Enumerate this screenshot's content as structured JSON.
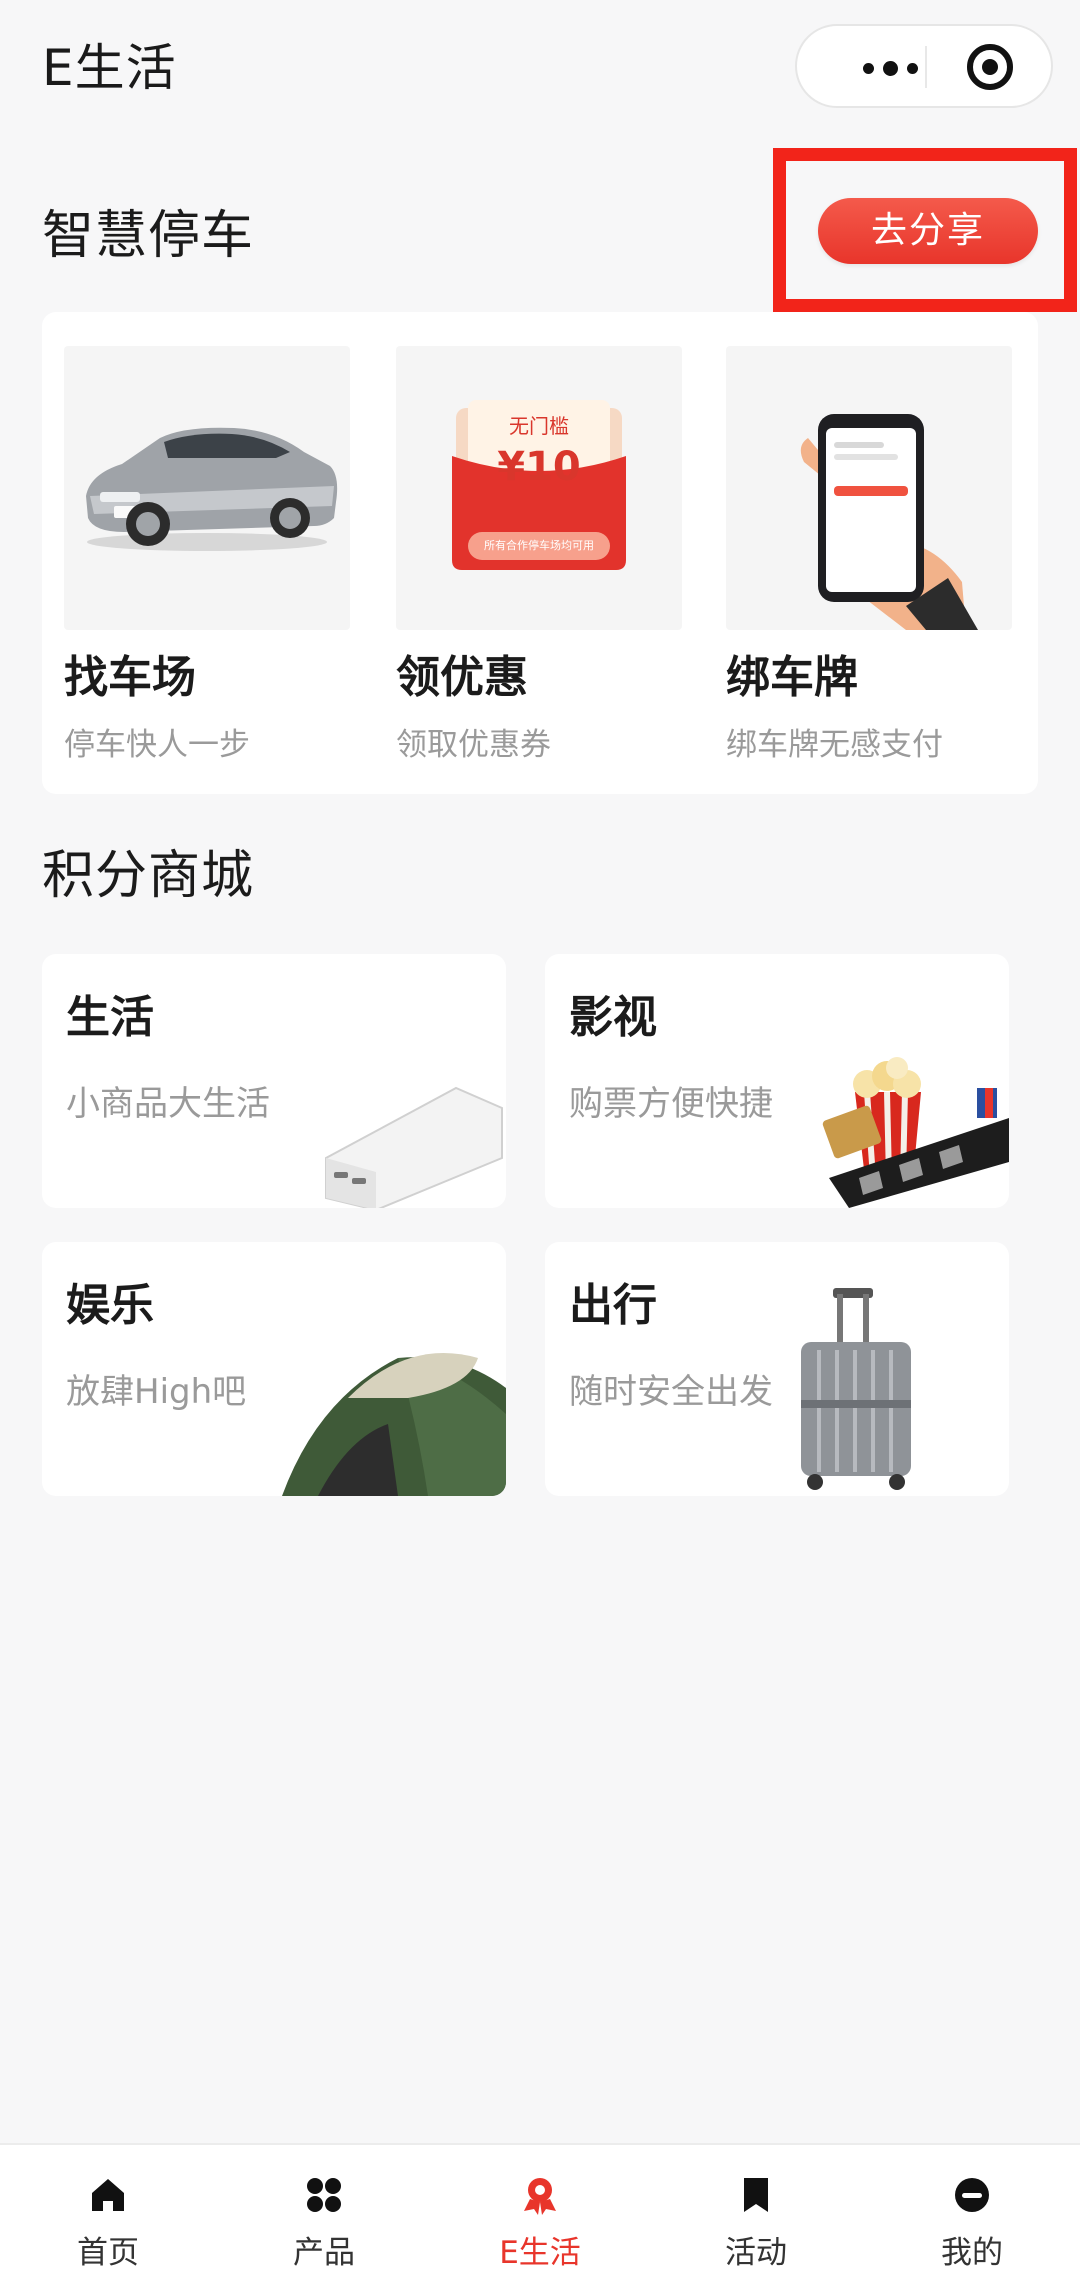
{
  "header": {
    "title": "E生活"
  },
  "capsule": {
    "more_icon": "more-dots-icon",
    "close_icon": "target-icon"
  },
  "parking": {
    "title": "智慧停车",
    "share_label": "去分享",
    "items": [
      {
        "title": "找车场",
        "subtitle": "停车快人一步",
        "icon": "car-image"
      },
      {
        "title": "领优惠",
        "subtitle": "领取优惠券",
        "icon": "coupon-image",
        "coupon": {
          "top": "无门槛",
          "amount": "¥10",
          "note": "所有合作停车场均可用"
        }
      },
      {
        "title": "绑车牌",
        "subtitle": "绑车牌无感支付",
        "icon": "phone-in-hand-image"
      }
    ]
  },
  "mall": {
    "title": "积分商城",
    "items": [
      {
        "title": "生活",
        "subtitle": "小商品大生活",
        "icon": "power-bank-image"
      },
      {
        "title": "影视",
        "subtitle": "购票方便快捷",
        "icon": "popcorn-film-image"
      },
      {
        "title": "娱乐",
        "subtitle": "放肆High吧",
        "icon": "tent-image"
      },
      {
        "title": "出行",
        "subtitle": "随时安全出发",
        "icon": "suitcase-image"
      }
    ]
  },
  "tabbar": {
    "items": [
      {
        "label": "首页",
        "icon": "home-icon",
        "active": false
      },
      {
        "label": "产品",
        "icon": "grid-icon",
        "active": false
      },
      {
        "label": "E生活",
        "icon": "ribbon-icon",
        "active": true
      },
      {
        "label": "活动",
        "icon": "bookmark-icon",
        "active": false
      },
      {
        "label": "我的",
        "icon": "user-icon",
        "active": false
      }
    ]
  },
  "colors": {
    "accent": "#e8352b",
    "highlight": "#f2241a",
    "background": "#f7f7f8"
  }
}
